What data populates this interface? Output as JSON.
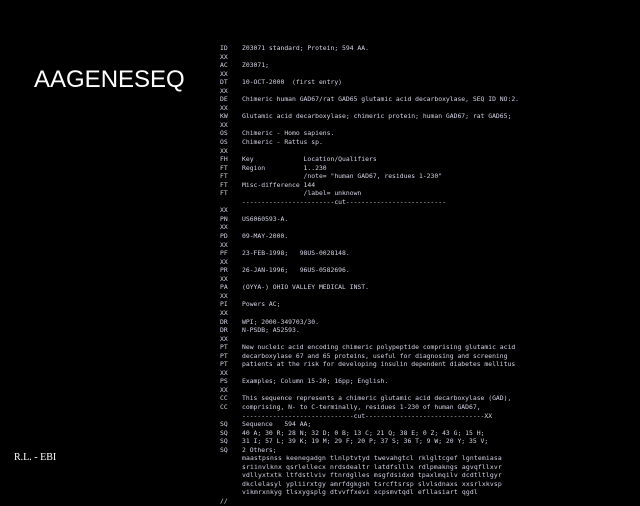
{
  "slide": {
    "title": "AAGENESEQ",
    "footer": "R.L. - EBI"
  },
  "entry_lines": [
    {
      "code": "ID",
      "text": "Z03071 standard; Protein; 594 AA."
    },
    {
      "code": "XX",
      "text": ""
    },
    {
      "code": "AC",
      "text": "Z03071;"
    },
    {
      "code": "XX",
      "text": ""
    },
    {
      "code": "DT",
      "text": "10-OCT-2000  (first entry)"
    },
    {
      "code": "XX",
      "text": ""
    },
    {
      "code": "DE",
      "text": "Chimeric human GAD67/rat GAD65 glutamic acid decarboxylase, SEQ ID NO:2."
    },
    {
      "code": "XX",
      "text": ""
    },
    {
      "code": "KW",
      "text": "Glutamic acid decarboxylase; chimeric protein; human GAD67; rat GAD65;"
    },
    {
      "code": "XX",
      "text": ""
    },
    {
      "code": "OS",
      "text": "Chimeric - Homo sapiens."
    },
    {
      "code": "OS",
      "text": "Chimeric - Rattus sp."
    },
    {
      "code": "XX",
      "text": ""
    },
    {
      "code": "FH",
      "text": "Key             Location/Qualifiers"
    },
    {
      "code": "FT",
      "text": "Region          1..230"
    },
    {
      "code": "FT",
      "text": "                /note= \"human GAD67, residues 1-230\""
    },
    {
      "code": "FT",
      "text": "Misc-difference 144"
    },
    {
      "code": "FT",
      "text": "                /label= unknown"
    },
    {
      "code": "",
      "text": "------------------------cut--------------------------"
    },
    {
      "code": "XX",
      "text": ""
    },
    {
      "code": "PN",
      "text": "US6060593-A."
    },
    {
      "code": "XX",
      "text": ""
    },
    {
      "code": "PD",
      "text": "09-MAY-2000."
    },
    {
      "code": "XX",
      "text": ""
    },
    {
      "code": "PF",
      "text": "23-FEB-1998;   98US-0028148."
    },
    {
      "code": "XX",
      "text": ""
    },
    {
      "code": "PR",
      "text": "26-JAN-1996;   96US-0582696."
    },
    {
      "code": "XX",
      "text": ""
    },
    {
      "code": "PA",
      "text": "(OYYA-) OHIO VALLEY MEDICAL INST."
    },
    {
      "code": "XX",
      "text": ""
    },
    {
      "code": "PI",
      "text": "Powers AC;"
    },
    {
      "code": "XX",
      "text": ""
    },
    {
      "code": "DR",
      "text": "WPI; 2000-349703/30."
    },
    {
      "code": "DR",
      "text": "N-PSDB; A52593."
    },
    {
      "code": "XX",
      "text": ""
    },
    {
      "code": "PT",
      "text": "New nucleic acid encoding chimeric polypeptide comprising glutamic acid"
    },
    {
      "code": "PT",
      "text": "decarboxylase 67 and 65 proteins, useful for diagnosing and screening"
    },
    {
      "code": "PT",
      "text": "patients at the risk for developing insulin dependent diabetes mellitus"
    },
    {
      "code": "XX",
      "text": ""
    },
    {
      "code": "PS",
      "text": "Examples; Column 15-20; 16pp; English."
    },
    {
      "code": "XX",
      "text": ""
    },
    {
      "code": "CC",
      "text": "This sequence represents a chimeric glutamic acid decarboxylase (GAD),"
    },
    {
      "code": "CC",
      "text": "comprising, N- to C-terminally, residues 1-230 of human GAD67,"
    },
    {
      "code": "",
      "text": "-----------------------------cut-------------------------------XX"
    },
    {
      "code": "SQ",
      "text": "Sequence   594 AA;"
    },
    {
      "code": "SQ",
      "text": "40 A; 30 R; 28 N; 32 D; 0 B; 13 C; 21 Q; 38 E; 0 Z; 43 G; 15 H;"
    },
    {
      "code": "SQ",
      "text": "31 I; 57 L; 39 K; 19 M; 29 F; 20 P; 37 S; 36 T; 9 W; 20 Y; 35 V;"
    },
    {
      "code": "SQ",
      "text": "2 Others;"
    },
    {
      "code": "",
      "text": "maastpsnss keenegadgn tlnlptvtyd twevahgtcl rklgltcgef lgntemiasa",
      "seq": true
    },
    {
      "code": "",
      "text": "sriinvlknx qsrlellecx nrdsdealtr latdfslllx rdlpmakngs agvqfllxvr",
      "seq": true
    },
    {
      "code": "",
      "text": "vdllyxtxtk ltfdstlviv ftnrdglles msgfdsidxd tpaxlmqilv dcdtltlgyr",
      "seq": true
    },
    {
      "code": "",
      "text": "dkclelasyl ypliirxtgy amrfdgkgsh tsrcftsrsp slvlsdnaxs xxsrlxkvsp",
      "seq": true
    },
    {
      "code": "",
      "text": "vikmrxnkyg tlsxygsplg dtvvffxevi xcpsmvtqdl efllasiart qgdl",
      "seq": true
    },
    {
      "code": "//",
      "text": ""
    }
  ]
}
